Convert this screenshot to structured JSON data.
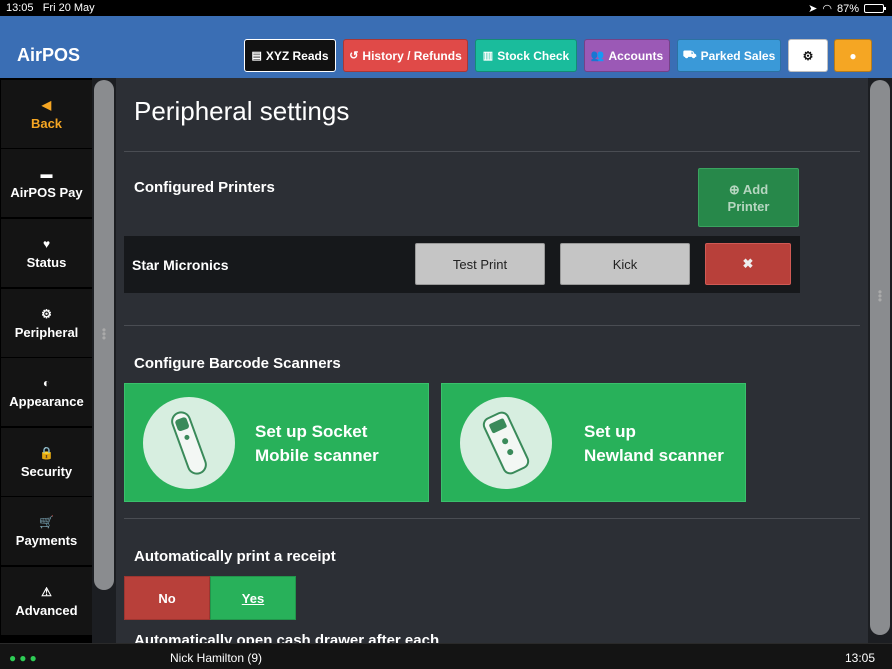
{
  "status_bar": {
    "time": "13:05",
    "date": "Fri 20 May",
    "battery": "87%"
  },
  "header": {
    "title": "AirPOS",
    "buttons": {
      "xyz": {
        "label": "XYZ Reads",
        "color": "#111111"
      },
      "history": {
        "label": "History / Refunds",
        "color": "#e04a48"
      },
      "stock": {
        "label": "Stock Check",
        "color": "#1abc9c"
      },
      "accounts": {
        "label": "Accounts",
        "color": "#9b59b6"
      },
      "parked": {
        "label": "Parked Sales",
        "color": "#3a99d8"
      },
      "settings_icon": "gear-icon",
      "user_icon": "user-icon"
    }
  },
  "sidebar": {
    "items": [
      {
        "label": "Back",
        "icon": "back-icon"
      },
      {
        "label": "AirPOS Pay",
        "icon": "card-icon"
      },
      {
        "label": "Status",
        "icon": "heartbeat-icon"
      },
      {
        "label": "Peripheral",
        "icon": "gear-icon"
      },
      {
        "label": "Appearance",
        "icon": "contrast-icon"
      },
      {
        "label": "Security",
        "icon": "lock-icon"
      },
      {
        "label": "Payments",
        "icon": "cart-icon"
      },
      {
        "label": "Advanced",
        "icon": "warning-icon"
      }
    ]
  },
  "main": {
    "title": "Peripheral settings",
    "printers": {
      "heading": "Configured Printers",
      "add_label_line1": "Add",
      "add_label_line2": "Printer",
      "rows": [
        {
          "name": "Star Micronics",
          "test_label": "Test Print",
          "kick_label": "Kick"
        }
      ]
    },
    "scanners": {
      "heading": "Configure Barcode Scanners",
      "socket": {
        "line1": "Set up Socket",
        "line2": "Mobile scanner"
      },
      "newland": {
        "line1": "Set up",
        "line2": "Newland scanner"
      }
    },
    "auto_print": {
      "heading": "Automatically print a receipt",
      "no_label": "No",
      "yes_label": "Yes",
      "selected": "Yes"
    },
    "auto_drawer": {
      "heading": "Automatically open cash drawer after each"
    }
  },
  "footer": {
    "user": "Nick Hamilton (9)",
    "time": "13:05"
  }
}
